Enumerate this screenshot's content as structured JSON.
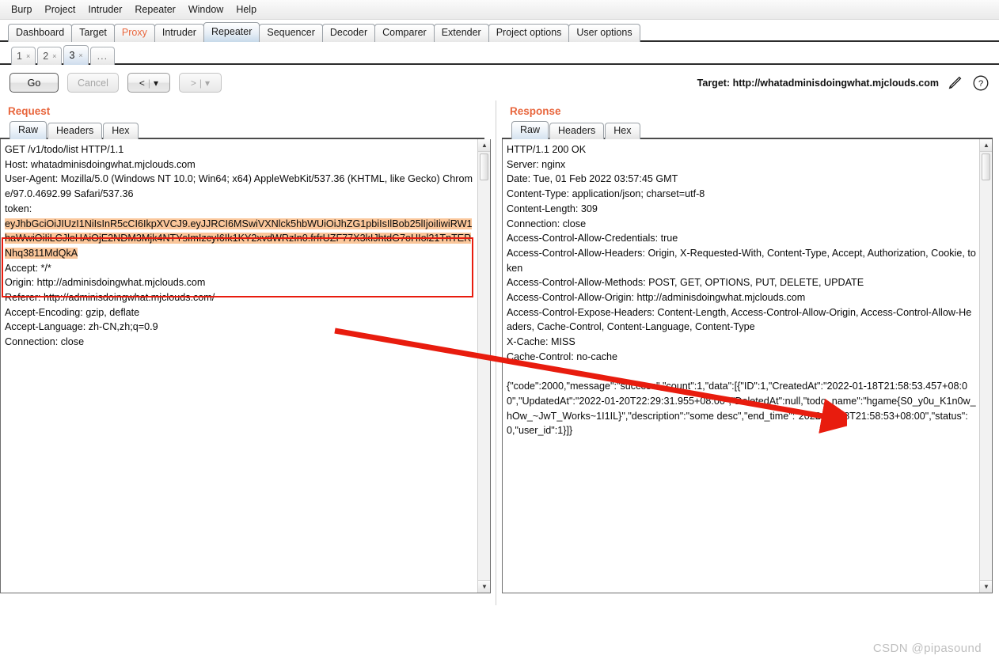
{
  "menu": {
    "items": [
      "Burp",
      "Project",
      "Intruder",
      "Repeater",
      "Window",
      "Help"
    ]
  },
  "main_tabs": [
    {
      "label": "Dashboard",
      "selected": false,
      "accent": false
    },
    {
      "label": "Target",
      "selected": false,
      "accent": false
    },
    {
      "label": "Proxy",
      "selected": false,
      "accent": true
    },
    {
      "label": "Intruder",
      "selected": false,
      "accent": false
    },
    {
      "label": "Repeater",
      "selected": true,
      "accent": false
    },
    {
      "label": "Sequencer",
      "selected": false,
      "accent": false
    },
    {
      "label": "Decoder",
      "selected": false,
      "accent": false
    },
    {
      "label": "Comparer",
      "selected": false,
      "accent": false
    },
    {
      "label": "Extender",
      "selected": false,
      "accent": false
    },
    {
      "label": "Project options",
      "selected": false,
      "accent": false
    },
    {
      "label": "User options",
      "selected": false,
      "accent": false
    }
  ],
  "repeater_tabs": [
    {
      "label": "1",
      "close": "×",
      "selected": false
    },
    {
      "label": "2",
      "close": "×",
      "selected": false
    },
    {
      "label": "3",
      "close": "×",
      "selected": true
    }
  ],
  "repeater_tabs_more": "...",
  "toolbar": {
    "go_label": "Go",
    "cancel_label": "Cancel",
    "back_label": "<",
    "back_caret": "▾",
    "forward_label": ">",
    "forward_caret": "▾",
    "separator": "|",
    "target_label": "Target: http://whatadminisdoingwhat.mjclouds.com",
    "edit_icon_name": "pencil-icon",
    "help_icon_name": "help-icon"
  },
  "request": {
    "title": "Request",
    "tabs": [
      {
        "label": "Raw",
        "selected": true
      },
      {
        "label": "Headers",
        "selected": false
      },
      {
        "label": "Hex",
        "selected": false
      }
    ],
    "lines_before": [
      "GET /v1/todo/list HTTP/1.1",
      "Host: whatadminisdoingwhat.mjclouds.com",
      "User-Agent: Mozilla/5.0 (Windows NT 10.0; Win64; x64) AppleWebKit/537.36 (KHTML, like Gecko) Chrome/97.0.4692.99 Safari/537.36",
      "token:"
    ],
    "token_highlight": "eyJhbGciOiJIUzI1NiIsInR5cCI6IkpXVCJ9.eyJJRCI6MSwiVXNlck5hbWUiOiJhZG1pbiIsIlBob25lIjoiIiwiRW1haWwiOiIiLCJleHAiOjE2NDM3Mjk4NTYsImIzcyI6Ik1KY2xvdWRzIn0.frfrUZF77X3kIJhtdG7oHIol21TnTERNhq3811MdQkA",
    "lines_after": [
      "Accept: */*",
      "Origin: http://adminisdoingwhat.mjclouds.com",
      "Referer: http://adminisdoingwhat.mjclouds.com/",
      "Accept-Encoding: gzip, deflate",
      "Accept-Language: zh-CN,zh;q=0.9",
      "Connection: close"
    ]
  },
  "response": {
    "title": "Response",
    "tabs": [
      {
        "label": "Raw",
        "selected": true
      },
      {
        "label": "Headers",
        "selected": false
      },
      {
        "label": "Hex",
        "selected": false
      }
    ],
    "headers": [
      "HTTP/1.1 200 OK",
      "Server: nginx",
      "Date: Tue, 01 Feb 2022 03:57:45 GMT",
      "Content-Type: application/json; charset=utf-8",
      "Content-Length: 309",
      "Connection: close",
      "Access-Control-Allow-Credentials: true",
      "Access-Control-Allow-Headers: Origin, X-Requested-With, Content-Type, Accept, Authorization, Cookie, token",
      "Access-Control-Allow-Methods: POST, GET, OPTIONS, PUT, DELETE, UPDATE",
      "Access-Control-Allow-Origin: http://adminisdoingwhat.mjclouds.com",
      "Access-Control-Expose-Headers: Content-Length, Access-Control-Allow-Origin, Access-Control-Allow-Headers, Cache-Control, Content-Language, Content-Type",
      "X-Cache: MISS",
      "Cache-Control: no-cache"
    ],
    "body": "{\"code\":2000,\"message\":\"success\",\"count\":1,\"data\":[{\"ID\":1,\"CreatedAt\":\"2022-01-18T21:58:53.457+08:00\",\"UpdatedAt\":\"2022-01-20T22:29:31.955+08:00\",\"DeletedAt\":null,\"todo_name\":\"hgame{S0_y0u_K1n0w_hOw_~JwT_Works~1I1IL}\",\"description\":\"some desc\",\"end_time\":\"2022-01-18T21:58:53+08:00\",\"status\":0,\"user_id\":1}]}"
  },
  "watermark": "CSDN @pipasound",
  "colors": {
    "accent": "#e8663d",
    "annotation": "#e81c0e",
    "highlight": "#fac69a",
    "selected_tab": "#d4e2ef"
  }
}
